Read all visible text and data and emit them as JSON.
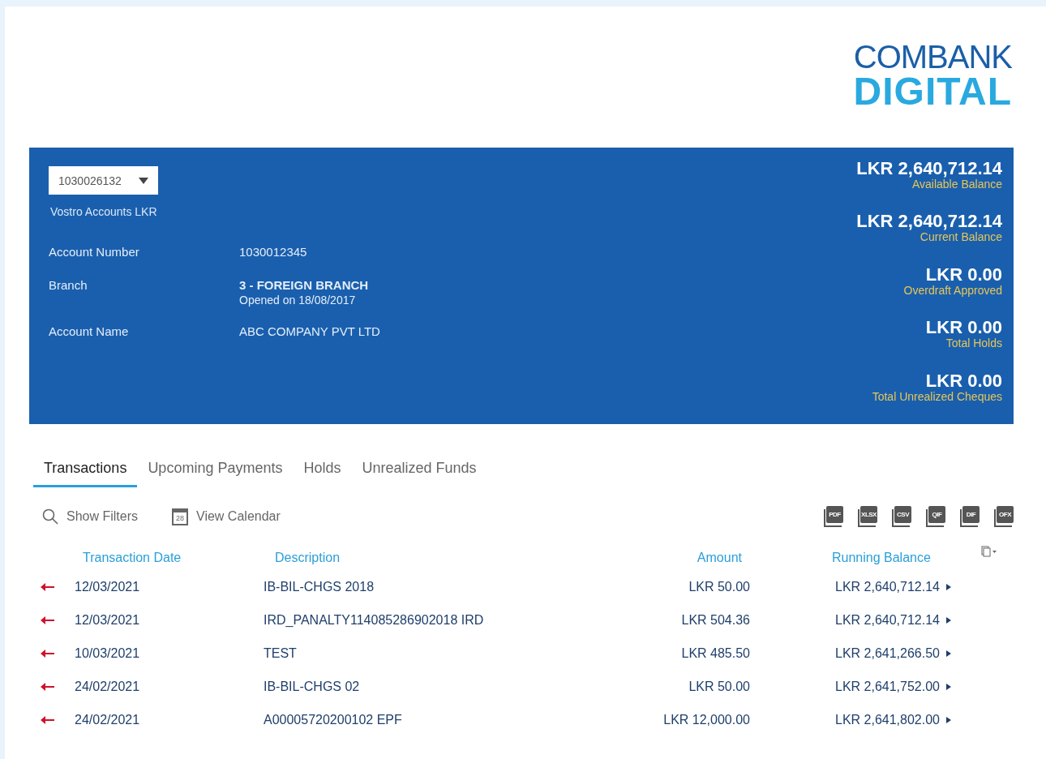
{
  "logo": {
    "line_1": "COMBANK",
    "line_2": "DIGITAL"
  },
  "account": {
    "selector": "1030026132",
    "type": "Vostro Accounts LKR",
    "details": [
      {
        "label": "Account Number",
        "value": "1030012345"
      },
      {
        "label": "Branch",
        "value": "3 - FOREIGN BRANCH",
        "note": "Opened on 18/08/2017"
      },
      {
        "label": "Account Name",
        "value": "ABC COMPANY PVT LTD"
      }
    ],
    "balances": [
      {
        "amount": "LKR 2,640,712.14",
        "label": "Available Balance"
      },
      {
        "amount": "LKR 2,640,712.14",
        "label": "Current Balance"
      },
      {
        "amount": "LKR 0.00",
        "label": "Overdraft Approved"
      },
      {
        "amount": "LKR 0.00",
        "label": "Total Holds"
      },
      {
        "amount": "LKR 0.00",
        "label": "Total Unrealized Cheques"
      }
    ]
  },
  "tabs": [
    {
      "label": "Transactions",
      "selected": true
    },
    {
      "label": "Upcoming Payments",
      "selected": false
    },
    {
      "label": "Holds",
      "selected": false
    },
    {
      "label": "Unrealized Funds",
      "selected": false
    }
  ],
  "toolbar": {
    "filters": "Show Filters",
    "calendar": "View Calendar",
    "calendar_day": "28",
    "exports": [
      "PDF",
      "XLSX",
      "CSV",
      "QIF",
      "DIF",
      "OFX"
    ]
  },
  "table": {
    "columns": [
      "Transaction Date",
      "Description",
      "Amount",
      "Running Balance"
    ],
    "rows": [
      {
        "date": "12/03/2021",
        "description": "IB-BIL-CHGS 2018",
        "amount": "LKR 50.00",
        "balance": "LKR 2,640,712.14"
      },
      {
        "date": "12/03/2021",
        "description": "IRD_PANALTY114085286902018 IRD",
        "amount": "LKR 504.36",
        "balance": "LKR 2,640,712.14"
      },
      {
        "date": "10/03/2021",
        "description": "TEST",
        "amount": "LKR 485.50",
        "balance": "LKR 2,641,266.50"
      },
      {
        "date": "24/02/2021",
        "description": "IB-BIL-CHGS 02",
        "amount": "LKR 50.00",
        "balance": "LKR 2,641,752.00"
      },
      {
        "date": "24/02/2021",
        "description": "A00005720200102 EPF",
        "amount": "LKR 12,000.00",
        "balance": "LKR 2,641,802.00"
      }
    ]
  }
}
